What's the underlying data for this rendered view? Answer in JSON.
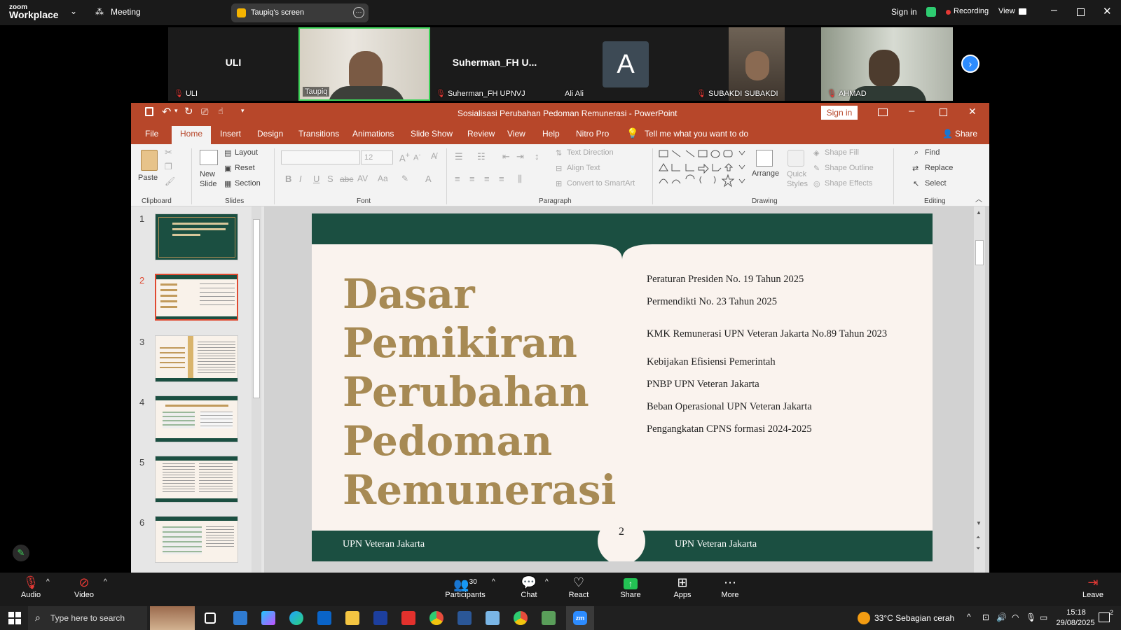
{
  "zoom": {
    "logo_top": "zoom",
    "logo_bottom": "Workplace",
    "meeting_label": "Meeting",
    "screen_label": "Taupiq's screen",
    "sign_in": "Sign in",
    "recording": "Recording",
    "view": "View"
  },
  "gallery": [
    {
      "big": "ULI",
      "name": "ULI"
    },
    {
      "big": "",
      "name": "Taupiq"
    },
    {
      "big": "Suherman_FH  U...",
      "name": "Suherman_FH UPNVJ"
    },
    {
      "big": "A",
      "name": "Ali Ali"
    },
    {
      "big": "",
      "name": "SUBAKDI SUBAKDI"
    },
    {
      "big": "",
      "name": "AHMAD"
    }
  ],
  "ppt": {
    "title": "Sosialisasi Perubahan Pedoman Remunerasi  -  PowerPoint",
    "sign_in": "Sign in",
    "tabs": [
      "File",
      "Home",
      "Insert",
      "Design",
      "Transitions",
      "Animations",
      "Slide Show",
      "Review",
      "View",
      "Help",
      "Nitro Pro"
    ],
    "tell_me": "Tell me what you want to do",
    "share": "Share",
    "ribbon": {
      "paste": "Paste",
      "new_slide": "New Slide",
      "layout": "Layout",
      "reset": "Reset",
      "section": "Section",
      "font_size": "12",
      "text_direction": "Text Direction",
      "align_text": "Align Text",
      "convert_smartart": "Convert to SmartArt",
      "arrange": "Arrange",
      "quick_styles": "Quick Styles",
      "shape_fill": "Shape Fill",
      "shape_outline": "Shape Outline",
      "shape_effects": "Shape Effects",
      "find": "Find",
      "replace": "Replace",
      "select": "Select",
      "groups": {
        "clipboard": "Clipboard",
        "slides": "Slides",
        "font": "Font",
        "paragraph": "Paragraph",
        "drawing": "Drawing",
        "editing": "Editing"
      }
    },
    "thumb_numbers": [
      "1",
      "2",
      "3",
      "4",
      "5",
      "6"
    ],
    "slide": {
      "title_lines": [
        "Dasar",
        "Pemikiran",
        "Perubahan",
        "Pedoman",
        "Remunerasi"
      ],
      "items": [
        "Peraturan Presiden No. 19 Tahun 2025",
        "Permendikti No. 23 Tahun 2025",
        "KMK Remunerasi UPN Veteran Jakarta No.89 Tahun 2023",
        "Kebijakan Efisiensi Pemerintah",
        "PNBP UPN Veteran Jakarta",
        "Beban Operasional UPN Veteran Jakarta",
        "Pengangkatan CPNS formasi 2024-2025"
      ],
      "footer_left": "UPN Veteran Jakarta",
      "footer_right": "UPN Veteran Jakarta",
      "page_number": "2"
    }
  },
  "bottom_bar": {
    "audio": "Audio",
    "video": "Video",
    "participants_count": "30",
    "participants": "Participants",
    "chat": "Chat",
    "react": "React",
    "share": "Share",
    "apps": "Apps",
    "more": "More",
    "leave": "Leave"
  },
  "taskbar": {
    "search_placeholder": "Type here to search",
    "weather": "33°C  Sebagian cerah",
    "time": "15:18",
    "date": "29/08/2025",
    "notif_count": "2"
  },
  "colors": {
    "ppt_accent": "#b7472a",
    "slide_green": "#1b4f41",
    "slide_gold": "#a78a54",
    "zoom_blue": "#2d8cff"
  }
}
